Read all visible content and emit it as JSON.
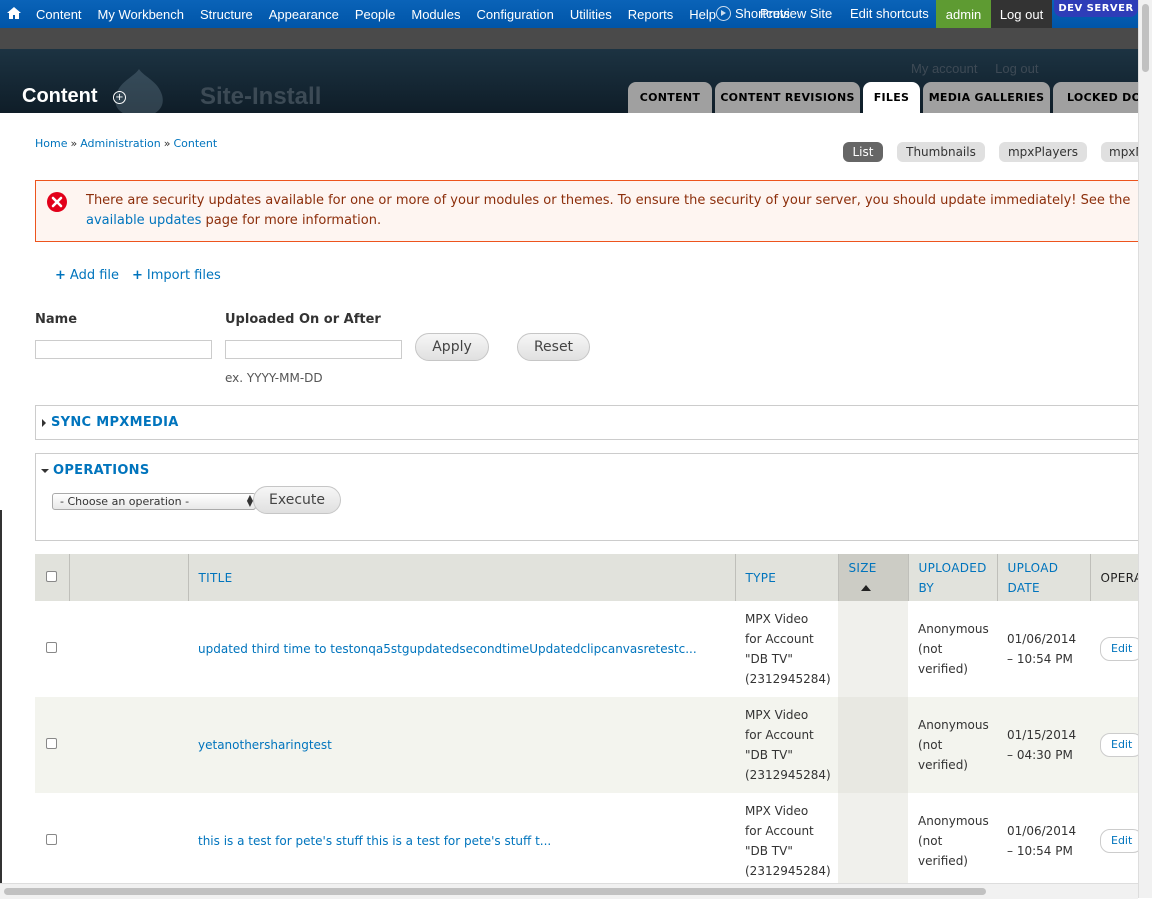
{
  "toolbar": {
    "menu": [
      "Content",
      "My Workbench",
      "Structure",
      "Appearance",
      "People",
      "Modules",
      "Configuration",
      "Utilities",
      "Reports",
      "Help"
    ],
    "shortcuts_label": "Shortcuts",
    "preview_site": "Preview Site",
    "edit_shortcuts": "Edit shortcuts",
    "admin": "admin",
    "logout": "Log out",
    "dev_server": "DEV SERVER"
  },
  "header": {
    "page_title": "Content",
    "site_name": "Site-Install",
    "my_account": "My account",
    "log_out": "Log out",
    "tabs": [
      "CONTENT",
      "CONTENT REVISIONS",
      "FILES",
      "MEDIA GALLERIES",
      "LOCKED DOCUMENTS"
    ],
    "active_tab": "FILES"
  },
  "breadcrumb": [
    "Home",
    "Administration",
    "Content"
  ],
  "view_tabs": [
    "List",
    "Thumbnails",
    "mpxPlayers",
    "mpxMedia"
  ],
  "alert": {
    "text": "There are security updates available for one or more of your modules or themes. To ensure the security of your server, you should update immediately! See the ",
    "link": "available updates",
    "suffix": " page for more information."
  },
  "actions": {
    "add_file": "Add file",
    "import_files": "Import files"
  },
  "filters": {
    "name_label": "Name",
    "name_value": "",
    "date_label": "Uploaded On or After",
    "date_value": "",
    "date_hint": "ex. YYYY-MM-DD",
    "apply": "Apply",
    "reset": "Reset"
  },
  "sync": {
    "legend": "SYNC MPXMEDIA"
  },
  "operations": {
    "legend": "OPERATIONS",
    "select_value": "- Choose an operation -",
    "execute": "Execute"
  },
  "table": {
    "headers": {
      "title": "TITLE",
      "type": "TYPE",
      "size": "SIZE",
      "uploaded_by": "UPLOADED BY",
      "upload_date": "UPLOAD DATE",
      "operations": "OPERATIONS"
    },
    "rows": [
      {
        "title": "updated third time to testonqa5stgupdatedsecondtimeUpdatedclipcanvasretestc...",
        "type": "MPX Video for Account \"DB TV\" (2312945284)",
        "size": "",
        "uploaded_by": "Anonymous (not verified)",
        "upload_date": "01/06/2014 – 10:54 PM",
        "op": "Edit"
      },
      {
        "title": "yetanothersharingtest",
        "type": "MPX Video for Account \"DB TV\" (2312945284)",
        "size": "",
        "uploaded_by": "Anonymous (not verified)",
        "upload_date": "01/15/2014 – 04:30 PM",
        "op": "Edit"
      },
      {
        "title": "this is a test for pete's stuff this is a test for pete's stuff t...",
        "type": "MPX Video for Account \"DB TV\" (2312945284)",
        "size": "",
        "uploaded_by": "Anonymous (not verified)",
        "upload_date": "01/06/2014 – 10:54 PM",
        "op": "Edit"
      }
    ]
  },
  "colors": {
    "toolbar": "#0a63b8",
    "link": "#0074bd",
    "alert_border": "#ed541d",
    "alert_text": "#8c2e0b",
    "admin_bg": "#5e9b32",
    "dev_server_bg": "#2e3db8"
  }
}
